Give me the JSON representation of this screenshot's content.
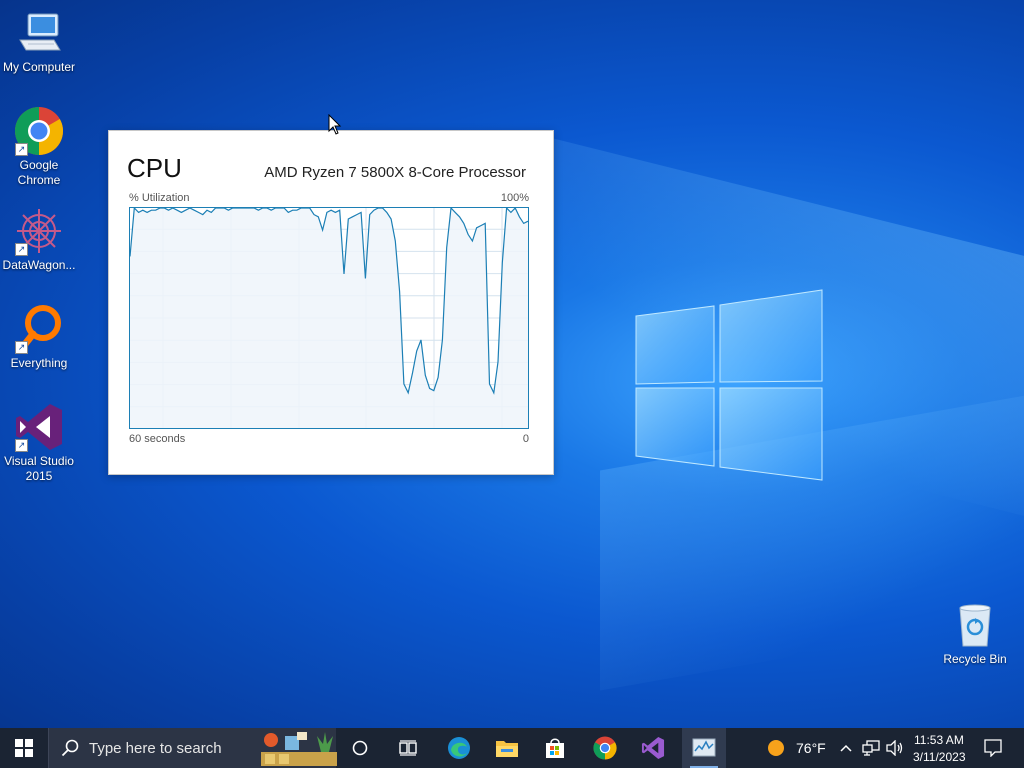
{
  "desktop": {
    "icons": [
      {
        "label": "My Computer"
      },
      {
        "label": "Google Chrome"
      },
      {
        "label": "DataWagon..."
      },
      {
        "label": "Everything"
      },
      {
        "label": "Visual Studio 2015"
      },
      {
        "label": "Recycle Bin"
      }
    ]
  },
  "cpu_widget": {
    "title": "CPU",
    "processor": "AMD Ryzen 7 5800X 8-Core Processor",
    "utilization_label": "% Utilization",
    "max_label": "100%",
    "time_left_label": "60 seconds",
    "time_right_label": "0",
    "utilization_history": [
      78,
      100,
      98,
      99,
      98,
      99,
      99,
      100,
      100,
      99,
      100,
      99,
      98,
      99,
      100,
      99,
      98,
      97,
      99,
      98,
      100,
      100,
      100,
      99,
      100,
      100,
      100,
      100,
      100,
      100,
      99,
      100,
      100,
      99,
      100,
      100,
      100,
      98,
      99,
      99,
      100,
      100,
      100,
      97,
      96,
      90,
      98,
      99,
      98,
      99,
      70,
      95,
      96,
      97,
      98,
      68,
      97,
      99,
      100,
      100,
      98,
      95,
      85,
      62,
      20,
      16,
      25,
      35,
      40,
      24,
      18,
      17,
      23,
      40,
      82,
      100,
      98,
      96,
      93,
      88,
      85,
      91,
      92,
      93,
      20,
      16,
      30,
      75,
      100,
      98,
      100,
      96,
      93,
      94
    ]
  },
  "taskbar": {
    "search_placeholder": "Type here to search",
    "weather_temp": "76°F",
    "clock_time": "11:53 AM",
    "clock_date": "3/11/2023"
  },
  "colors": {
    "graph_line": "#1c7fb5",
    "graph_fill": "#eef4fa",
    "graph_grid": "#d4e2ee",
    "taskbar": "#1b2433"
  }
}
